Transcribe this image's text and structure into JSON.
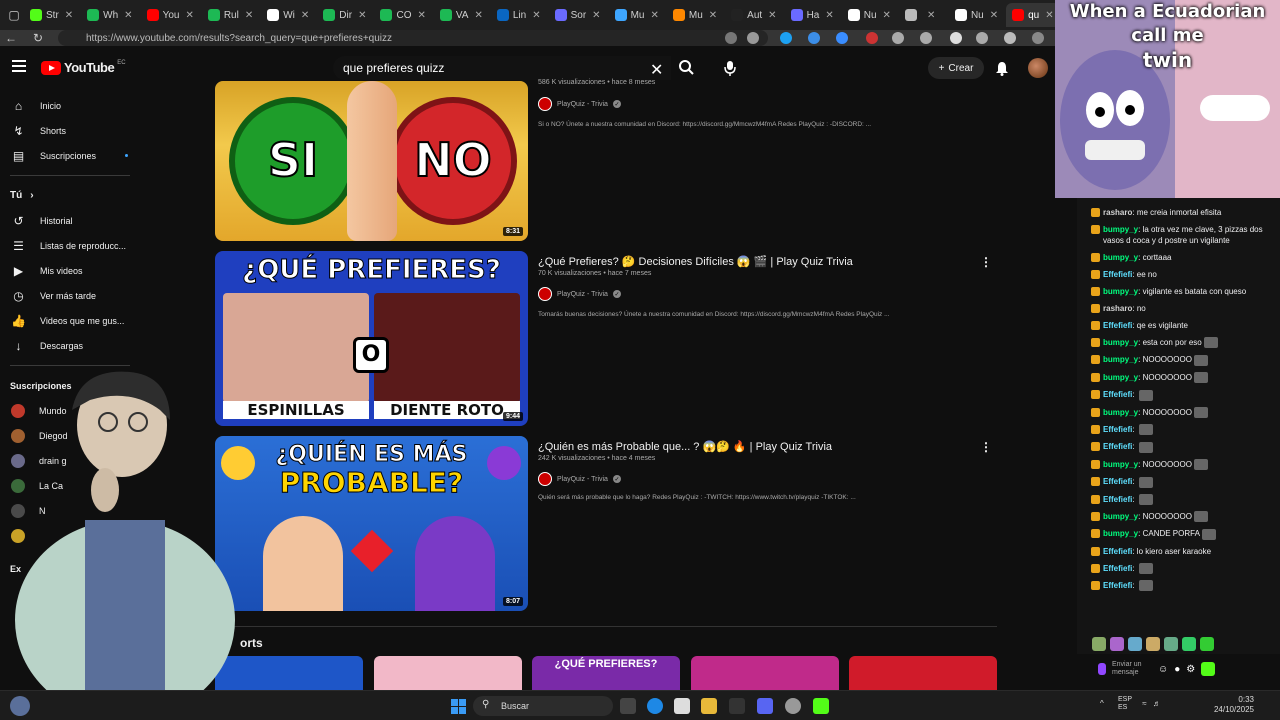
{
  "browser": {
    "tabs": [
      {
        "label": "Str",
        "color": "#53fc18"
      },
      {
        "label": "Wh",
        "color": "#1db954"
      },
      {
        "label": "You",
        "color": "#ff0000"
      },
      {
        "label": "Rul",
        "color": "#1db954"
      },
      {
        "label": "Wi",
        "color": "#ffffff"
      },
      {
        "label": "Dir",
        "color": "#1db954"
      },
      {
        "label": "CO",
        "color": "#1db954"
      },
      {
        "label": "VA",
        "color": "#1db954"
      },
      {
        "label": "Lin",
        "color": "#0a66c2"
      },
      {
        "label": "Sor",
        "color": "#6a6aff"
      },
      {
        "label": "Mu",
        "color": "#3ea6ff"
      },
      {
        "label": "Mu",
        "color": "#ff8800"
      },
      {
        "label": "Aut",
        "color": "#222222"
      },
      {
        "label": "Ha",
        "color": "#6a6aff"
      },
      {
        "label": "Nu",
        "color": "#ffffff"
      },
      {
        "label": "",
        "color": "#bbbbbb"
      },
      {
        "label": "Nu",
        "color": "#ffffff"
      },
      {
        "label": "qu",
        "color": "#ff0000"
      }
    ],
    "url": "https://www.youtube.com/results?search_query=que+prefieres+quizz"
  },
  "header": {
    "logo": "YouTube",
    "logo_cc": "EC",
    "search_value": "que prefieres quizz",
    "create_label": "Crear"
  },
  "sidebar": {
    "items": [
      {
        "label": "Inicio",
        "icon": "home-icon"
      },
      {
        "label": "Shorts",
        "icon": "shorts-icon"
      },
      {
        "label": "Suscripciones",
        "icon": "subscriptions-icon"
      }
    ],
    "you_label": "Tú",
    "you_items": [
      {
        "label": "Historial",
        "icon": "history-icon"
      },
      {
        "label": "Listas de reproducc...",
        "icon": "playlist-icon"
      },
      {
        "label": "Mis videos",
        "icon": "videos-icon"
      },
      {
        "label": "Ver más tarde",
        "icon": "clock-icon"
      },
      {
        "label": "Videos que me gus...",
        "icon": "like-icon"
      },
      {
        "label": "Descargas",
        "icon": "download-icon"
      }
    ],
    "subs_label": "Suscripciones",
    "subs": [
      {
        "label": "Mundo",
        "color": "#c0392b"
      },
      {
        "label": "Diegod",
        "color": "#a06030"
      },
      {
        "label": "drain g",
        "color": "#6a6a8a"
      },
      {
        "label": "La Ca",
        "color": "#3a6a3a"
      },
      {
        "label": "N",
        "color": "#4a4a4a"
      },
      {
        "label": "",
        "color": "#c9a227"
      }
    ],
    "explore_label": "Ex"
  },
  "videos": [
    {
      "title": "",
      "meta": "586 K visualizaciones • hace 8 meses",
      "channel": "PlayQuiz - Trivia",
      "desc": "Si o NO? Únete a nuestra comunidad en Discord: https://discord.gg/MmcwzM4fmA Redes PlayQuiz : -DISCORD: ...",
      "duration": "8:31",
      "thumb_lines": [
        "SI",
        "NO"
      ]
    },
    {
      "title": "¿Qué Prefieres? 🤔 Decisiones Difíciles 😱 🎬 | Play Quiz Trivia",
      "meta": "70 K visualizaciones • hace 7 meses",
      "channel": "PlayQuiz - Trivia",
      "desc": "Tomarás buenas decisiones? Únete a nuestra comunidad en Discord: https://discord.gg/MmcwzM4fmA Redes PlayQuiz ...",
      "duration": "9:44",
      "thumb_lines": [
        "¿QUÉ PREFIERES?",
        "ESPINILLAS",
        "DIENTE ROTO",
        "O"
      ]
    },
    {
      "title": "¿Quién es más Probable que... ? 😱🤔 🔥 | Play Quiz Trivia",
      "meta": "242 K visualizaciones • hace 4 meses",
      "channel": "PlayQuiz - Trivia",
      "desc": "Quién será más probable que lo haga? Redes PlayQuiz : -TWITCH: https://www.twitch.tv/playquiz -TIKTOK: ...",
      "duration": "8:07",
      "thumb_lines": [
        "¿QUIÉN ES MÁS",
        "PROBABLE?"
      ]
    }
  ],
  "shorts_label": "orts",
  "shorts_strip": [
    "",
    "",
    "¿QUÉ PREFIERES?",
    "",
    ""
  ],
  "meme": {
    "caption_line1": "When a Ecuadorian call me",
    "caption_line2": "twin"
  },
  "chat": [
    {
      "user": "rasharo",
      "color": "#d3d3d3",
      "text": "me creia inmortal efisita"
    },
    {
      "user": "bumpy_y",
      "color": "#00ff7f",
      "text": "la otra vez me clave, 3 pizzas dos vasos d coca y d postre un vigilante"
    },
    {
      "user": "bumpy_y",
      "color": "#00ff7f",
      "text": "corttaaa"
    },
    {
      "user": "Effefiefi",
      "color": "#5fe0ff",
      "text": "ee no"
    },
    {
      "user": "bumpy_y",
      "color": "#00ff7f",
      "text": "vigilante es batata con queso"
    },
    {
      "user": "rasharo",
      "color": "#d3d3d3",
      "text": "no"
    },
    {
      "user": "Effefiefi",
      "color": "#5fe0ff",
      "text": "qe es vigilante"
    },
    {
      "user": "bumpy_y",
      "color": "#00ff7f",
      "text": "esta con  por eso"
    },
    {
      "user": "bumpy_y",
      "color": "#00ff7f",
      "text": "NOOOOOOO"
    },
    {
      "user": "bumpy_y",
      "color": "#00ff7f",
      "text": "NOOOOOOO"
    },
    {
      "user": "Effefiefi",
      "color": "#5fe0ff",
      "text": ""
    },
    {
      "user": "bumpy_y",
      "color": "#00ff7f",
      "text": "NOOOOOOO"
    },
    {
      "user": "Effefiefi",
      "color": "#5fe0ff",
      "text": ""
    },
    {
      "user": "Effefiefi",
      "color": "#5fe0ff",
      "text": ""
    },
    {
      "user": "bumpy_y",
      "color": "#00ff7f",
      "text": "NOOOOOOO"
    },
    {
      "user": "Effefiefi",
      "color": "#5fe0ff",
      "text": ""
    },
    {
      "user": "Effefiefi",
      "color": "#5fe0ff",
      "text": ""
    },
    {
      "user": "bumpy_y",
      "color": "#00ff7f",
      "text": "NOOOOOOO"
    },
    {
      "user": "bumpy_y",
      "color": "#00ff7f",
      "text": "CANDE PORFA"
    },
    {
      "user": "Effefiefi",
      "color": "#5fe0ff",
      "text": "lo kiero aser karaoke"
    },
    {
      "user": "Effefiefi",
      "color": "#5fe0ff",
      "text": ""
    },
    {
      "user": "Effefiefi",
      "color": "#5fe0ff",
      "text": ""
    }
  ],
  "chat_input_placeholder": "Enviar un mensaje",
  "taskbar": {
    "search_label": "Buscar",
    "lang_line1": "ESP",
    "lang_line2": "ES",
    "time": "0:33",
    "date": "24/10/2025"
  }
}
